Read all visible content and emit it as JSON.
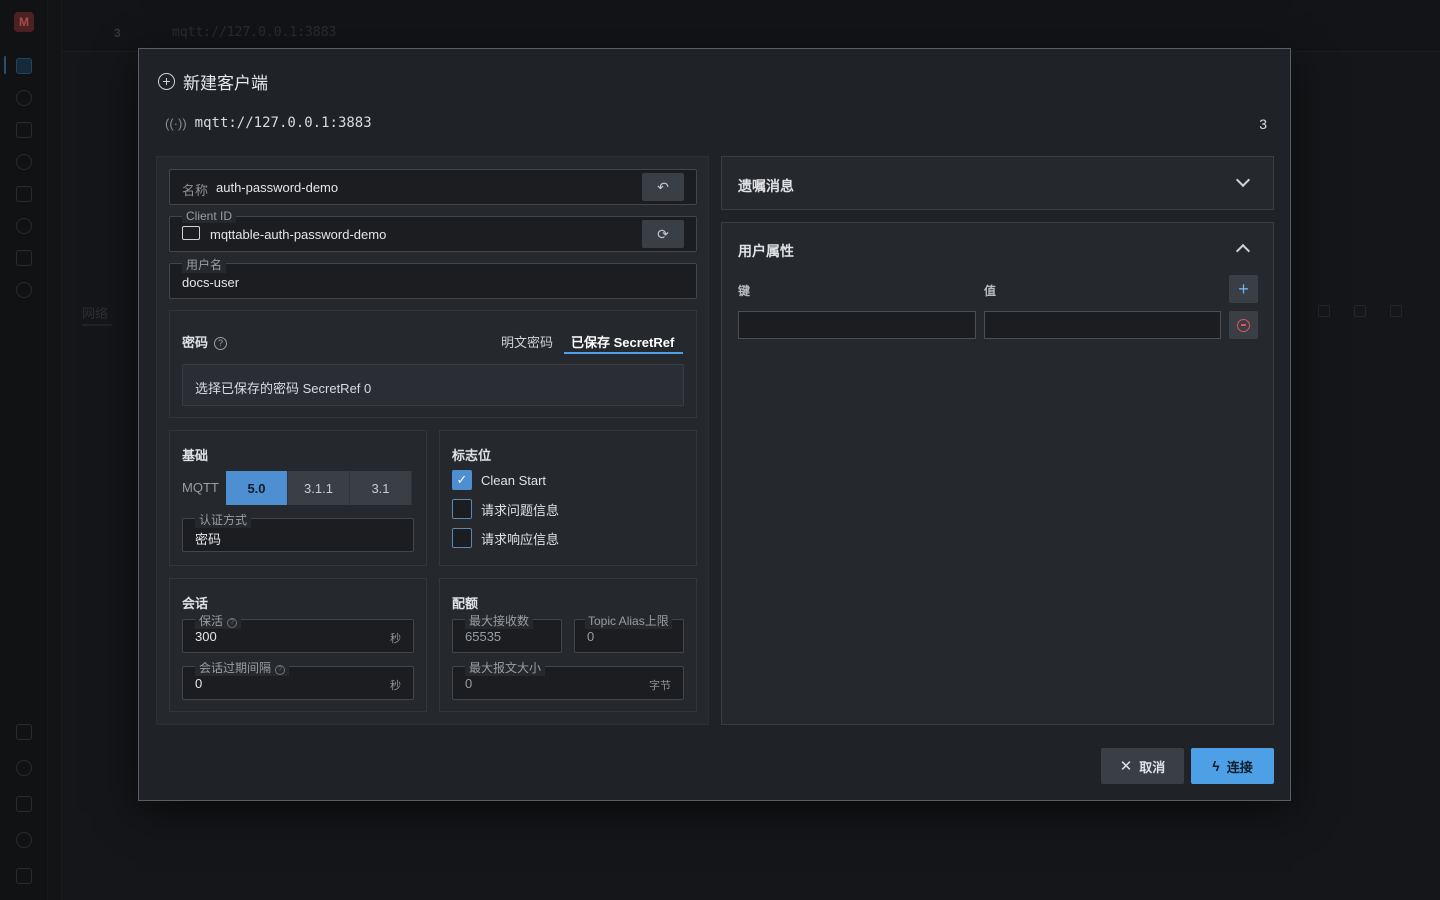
{
  "background": {
    "logo_letter": "M",
    "topbar_count": "3",
    "topbar_url": "mqtt://127.0.0.1:3883",
    "tab_label": "网络"
  },
  "dialog": {
    "title": "新建客户端",
    "url": "mqtt://127.0.0.1:3883",
    "count": "3"
  },
  "identity": {
    "name_label": "名称",
    "name_value": "auth-password-demo",
    "client_id_label": "Client ID",
    "client_id_value": "mqttable-auth-password-demo",
    "username_label": "用户名",
    "username_value": "docs-user"
  },
  "password": {
    "title": "密码",
    "tab_plain": "明文密码",
    "tab_secret": "已保存 SecretRef",
    "select_text": "选择已保存的密码 SecretRef 0"
  },
  "basic": {
    "title": "基础",
    "mqtt_label": "MQTT",
    "versions": [
      "5.0",
      "3.1.1",
      "3.1"
    ],
    "selected_version": "5.0",
    "auth_label": "认证方式",
    "auth_value": "密码"
  },
  "flags": {
    "title": "标志位",
    "items": [
      {
        "label": "Clean Start",
        "checked": true
      },
      {
        "label": "请求问题信息",
        "checked": false
      },
      {
        "label": "请求响应信息",
        "checked": false
      }
    ]
  },
  "session": {
    "title": "会话",
    "keepalive_label": "保活",
    "keepalive_value": "300",
    "keepalive_unit": "秒",
    "expiry_label": "会话过期间隔",
    "expiry_value": "0",
    "expiry_unit": "秒"
  },
  "quota": {
    "title": "配额",
    "max_receive_label": "最大接收数",
    "max_receive_value": "65535",
    "topic_alias_label": "Topic Alias上限",
    "topic_alias_value": "0",
    "max_packet_label": "最大报文大小",
    "max_packet_value": "0",
    "max_packet_unit": "字节"
  },
  "will": {
    "title": "遗嘱消息",
    "expanded": false
  },
  "user_props": {
    "title": "用户属性",
    "expanded": true,
    "key_header": "键",
    "value_header": "值",
    "rows": [
      {
        "key": "",
        "value": ""
      }
    ]
  },
  "actions": {
    "cancel": "取消",
    "connect": "连接"
  },
  "colors": {
    "accent": "#4d9fe6",
    "danger": "#e0545b",
    "panel": "#25282d",
    "dialog_bg": "#1f2227"
  }
}
